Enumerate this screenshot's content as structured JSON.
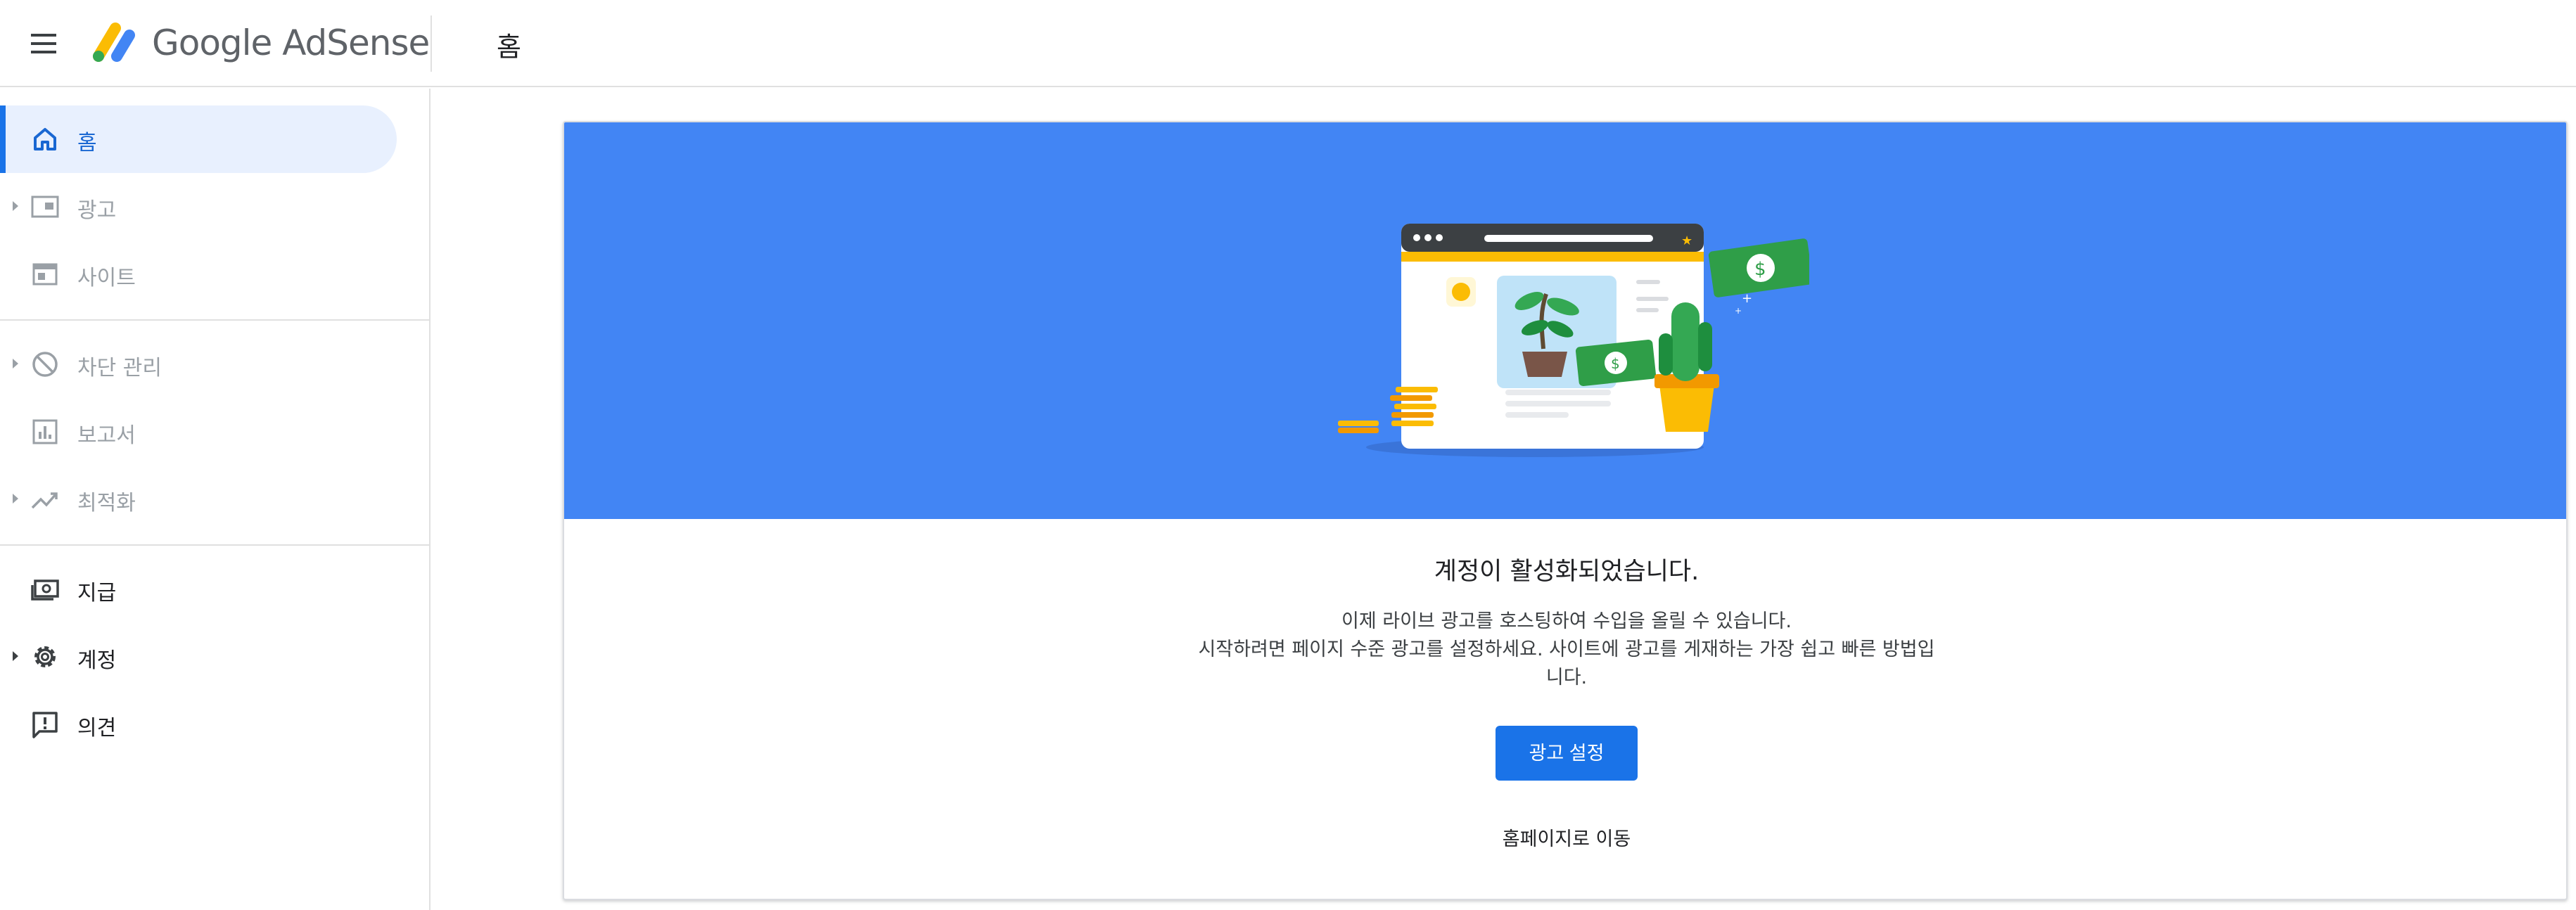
{
  "header": {
    "app_name": "Google AdSense",
    "page_title": "홈"
  },
  "sidebar": {
    "items": [
      {
        "label": "홈",
        "icon": "home-icon",
        "state": "active"
      },
      {
        "label": "광고",
        "icon": "ads-icon",
        "state": "disabled",
        "expandable": true
      },
      {
        "label": "사이트",
        "icon": "sites-icon",
        "state": "disabled"
      },
      {
        "label": "차단 관리",
        "icon": "block-icon",
        "state": "disabled",
        "expandable": true
      },
      {
        "label": "보고서",
        "icon": "reports-icon",
        "state": "disabled"
      },
      {
        "label": "최적화",
        "icon": "optimization-icon",
        "state": "disabled",
        "expandable": true
      },
      {
        "label": "지급",
        "icon": "payments-icon",
        "state": "normal"
      },
      {
        "label": "계정",
        "icon": "gear-icon",
        "state": "normal",
        "expandable": true
      },
      {
        "label": "의견",
        "icon": "feedback-icon",
        "state": "normal"
      }
    ]
  },
  "card": {
    "title": "계정이 활성화되었습니다.",
    "description_line1": "이제 라이브 광고를 호스팅하여 수입을 올릴 수 있습니다.",
    "description_line2": "시작하려면 페이지 수준 광고를 설정하세요. 사이트에 광고를 게재하는 가장 쉽고 빠른 방법입니다.",
    "primary_button": "광고 설정",
    "secondary_link": "홈페이지로 이동"
  },
  "colors": {
    "accent": "#1a73e8",
    "hero_background": "#4285f4",
    "active_nav_background": "#e8f0fe",
    "disabled_text": "#9aa0a6"
  }
}
